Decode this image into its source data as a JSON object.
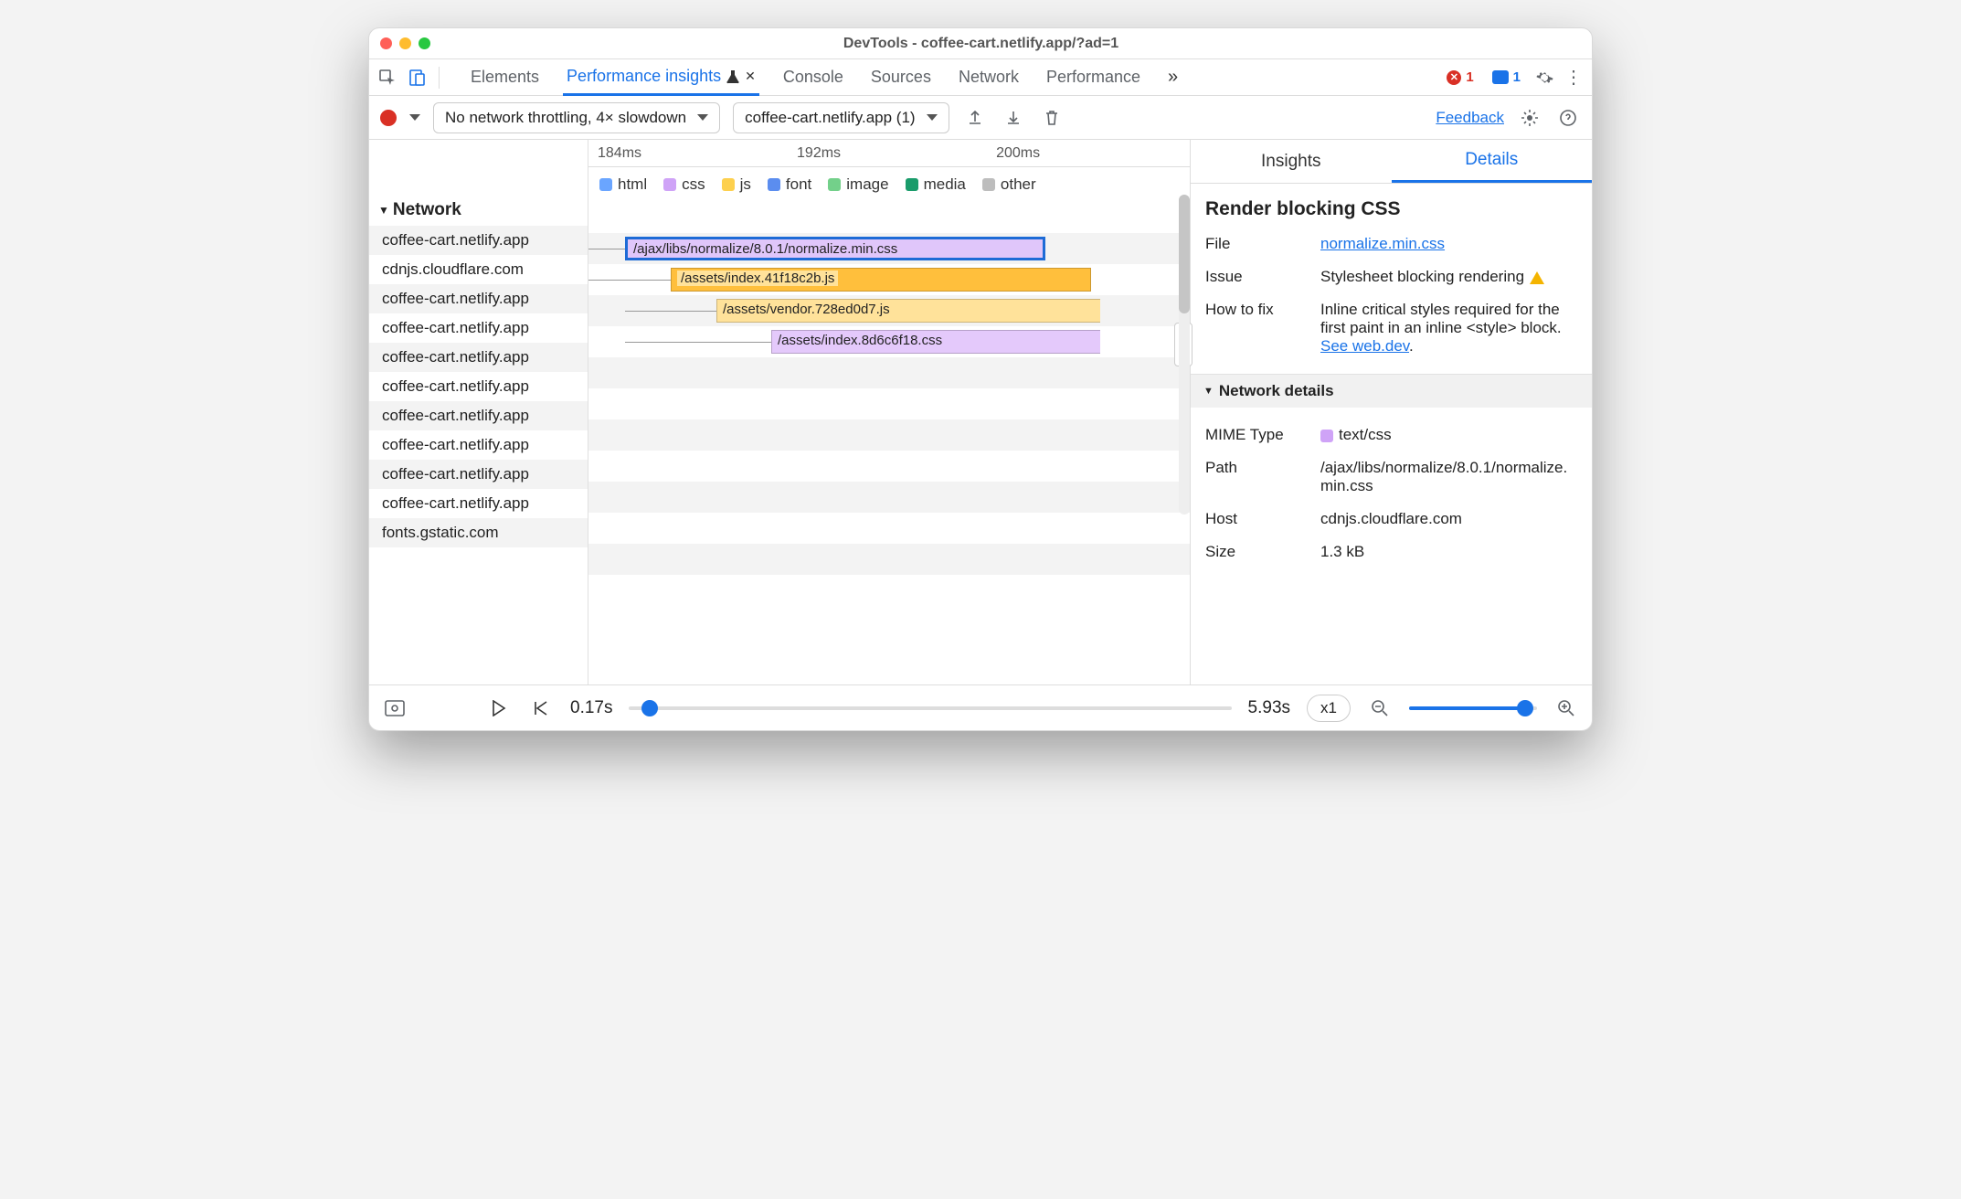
{
  "window": {
    "title": "DevTools - coffee-cart.netlify.app/?ad=1"
  },
  "topTabs": {
    "items": [
      "Elements",
      "Performance insights",
      "Console",
      "Sources",
      "Network",
      "Performance"
    ],
    "activeIndex": 1,
    "errorCount": "1",
    "messageCount": "1"
  },
  "toolbar": {
    "throttling": "No network throttling, 4× slowdown",
    "target": "coffee-cart.netlify.app (1)",
    "feedback": "Feedback"
  },
  "ruler": {
    "ticks": [
      "184ms",
      "192ms",
      "200ms"
    ]
  },
  "legend": {
    "items": [
      "html",
      "css",
      "js",
      "font",
      "image",
      "media",
      "other"
    ]
  },
  "left": {
    "section": "Network",
    "rows": [
      "coffee-cart.netlify.app",
      "cdnjs.cloudflare.com",
      "coffee-cart.netlify.app",
      "coffee-cart.netlify.app",
      "coffee-cart.netlify.app",
      "coffee-cart.netlify.app",
      "coffee-cart.netlify.app",
      "coffee-cart.netlify.app",
      "coffee-cart.netlify.app",
      "coffee-cart.netlify.app",
      "fonts.gstatic.com"
    ]
  },
  "bars": {
    "b1": "/ajax/libs/normalize/8.0.1/normalize.min.css",
    "b2": "/assets/index.41f18c2b.js",
    "b3": "/assets/vendor.728ed0d7.js",
    "b4": "/assets/index.8d6c6f18.css"
  },
  "rightTabs": {
    "items": [
      "Insights",
      "Details"
    ],
    "activeIndex": 1
  },
  "details": {
    "title": "Render blocking CSS",
    "file": {
      "k": "File",
      "v": "normalize.min.css"
    },
    "issue": {
      "k": "Issue",
      "v": "Stylesheet blocking rendering"
    },
    "fix": {
      "k": "How to fix",
      "v": "Inline critical styles required for the first paint in an inline <style> block. ",
      "link": "See web.dev"
    },
    "netHeader": "Network details",
    "mime": {
      "k": "MIME Type",
      "v": "text/css"
    },
    "path": {
      "k": "Path",
      "v": "/ajax/libs/normalize/8.0.1/normalize.min.css"
    },
    "host": {
      "k": "Host",
      "v": "cdnjs.cloudflare.com"
    },
    "size": {
      "k": "Size",
      "v": "1.3 kB"
    }
  },
  "footer": {
    "startTime": "0.17s",
    "endTime": "5.93s",
    "speed": "x1"
  }
}
